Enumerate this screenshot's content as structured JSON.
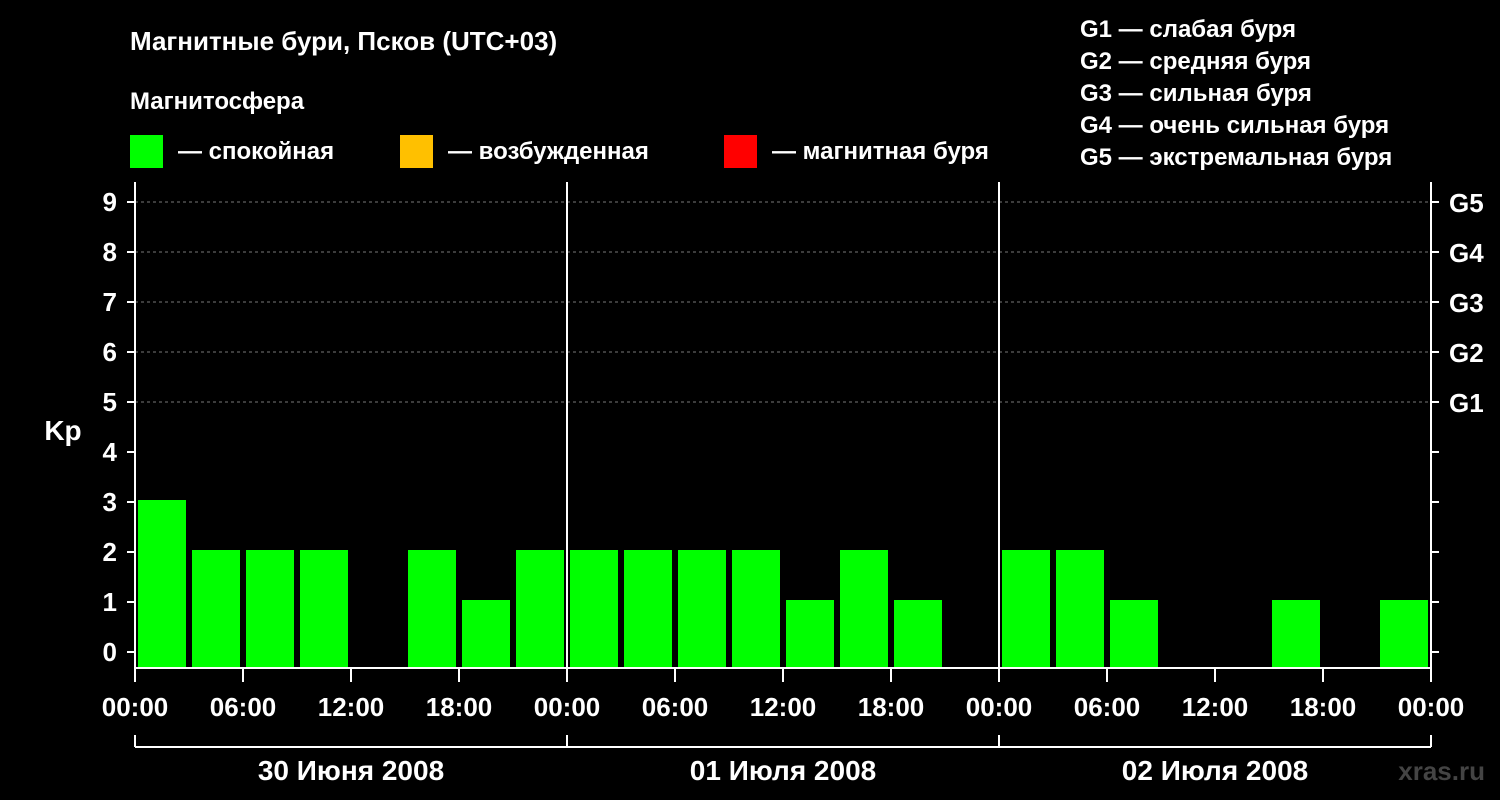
{
  "header": {
    "title": "Магнитные бури, Псков (UTC+03)",
    "subtitle": "Магнитосфера"
  },
  "legend": {
    "items": [
      {
        "label": "— спокойная",
        "color": "#00ff00"
      },
      {
        "label": "— возбужденная",
        "color": "#ffc000"
      },
      {
        "label": "— магнитная буря",
        "color": "#ff0000"
      }
    ],
    "g_scale": [
      "G1 — слабая буря",
      "G2 — средняя буря",
      "G3 — сильная буря",
      "G4 — очень сильная буря",
      "G5 — экстремальная буря"
    ]
  },
  "watermark": "xras.ru",
  "chart_data": {
    "type": "bar",
    "ylabel": "Kp",
    "ylim": [
      0,
      9
    ],
    "yticks": [
      "0",
      "1",
      "2",
      "3",
      "4",
      "5",
      "6",
      "7",
      "8",
      "9"
    ],
    "right_axis_labels": [
      {
        "kp": 5,
        "label": "G1"
      },
      {
        "kp": 6,
        "label": "G2"
      },
      {
        "kp": 7,
        "label": "G3"
      },
      {
        "kp": 8,
        "label": "G4"
      },
      {
        "kp": 9,
        "label": "G5"
      }
    ],
    "grid": "horizontal dashed at Kp 5–9",
    "xticks": [
      "00:00",
      "06:00",
      "12:00",
      "18:00",
      "00:00",
      "06:00",
      "12:00",
      "18:00",
      "00:00",
      "06:00",
      "12:00",
      "18:00",
      "00:00"
    ],
    "days": [
      "30 Июня 2008",
      "01 Июля 2008",
      "02 Июля 2008"
    ],
    "interval_hours": 3,
    "values": [
      3,
      2,
      2,
      2,
      0,
      2,
      1,
      2,
      2,
      2,
      2,
      2,
      1,
      2,
      1,
      0,
      2,
      2,
      1,
      0,
      0,
      1,
      0,
      1
    ],
    "colors": {
      "quiet": "#00ff00",
      "active": "#ffc000",
      "storm": "#ff0000"
    }
  }
}
